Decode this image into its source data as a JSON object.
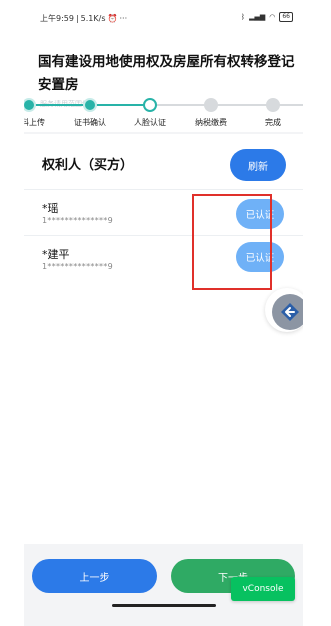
{
  "status_bar": {
    "time": "上午9:59",
    "network_speed": "5.1K/s",
    "battery": "66"
  },
  "header": {
    "title": "国有建设用地使用权及房屋所有权转移登记安置房"
  },
  "steps": {
    "watermark": "服务请用范围使安",
    "items": [
      {
        "label": "资料上传",
        "state": "done"
      },
      {
        "label": "证书确认",
        "state": "done"
      },
      {
        "label": "人脸认证",
        "state": "current"
      },
      {
        "label": "纳税缴费",
        "state": "todo"
      },
      {
        "label": "完成",
        "state": "todo"
      }
    ]
  },
  "rights_holder": {
    "title": "权利人（买方）",
    "refresh_label": "刷新",
    "persons": [
      {
        "name": "*瑶",
        "id_number": "1**************9",
        "status": "已认证"
      },
      {
        "name": "*建平",
        "id_number": "1**************9",
        "status": "已认证"
      }
    ]
  },
  "footer": {
    "prev_label": "上一步",
    "next_label": "下一步",
    "vconsole_label": "vConsole"
  },
  "colors": {
    "primary_blue": "#2c7ae8",
    "certified_blue": "#6fb1f7",
    "step_teal": "#28b3a8",
    "next_green": "#2faa64",
    "highlight_red": "#e0302a"
  }
}
